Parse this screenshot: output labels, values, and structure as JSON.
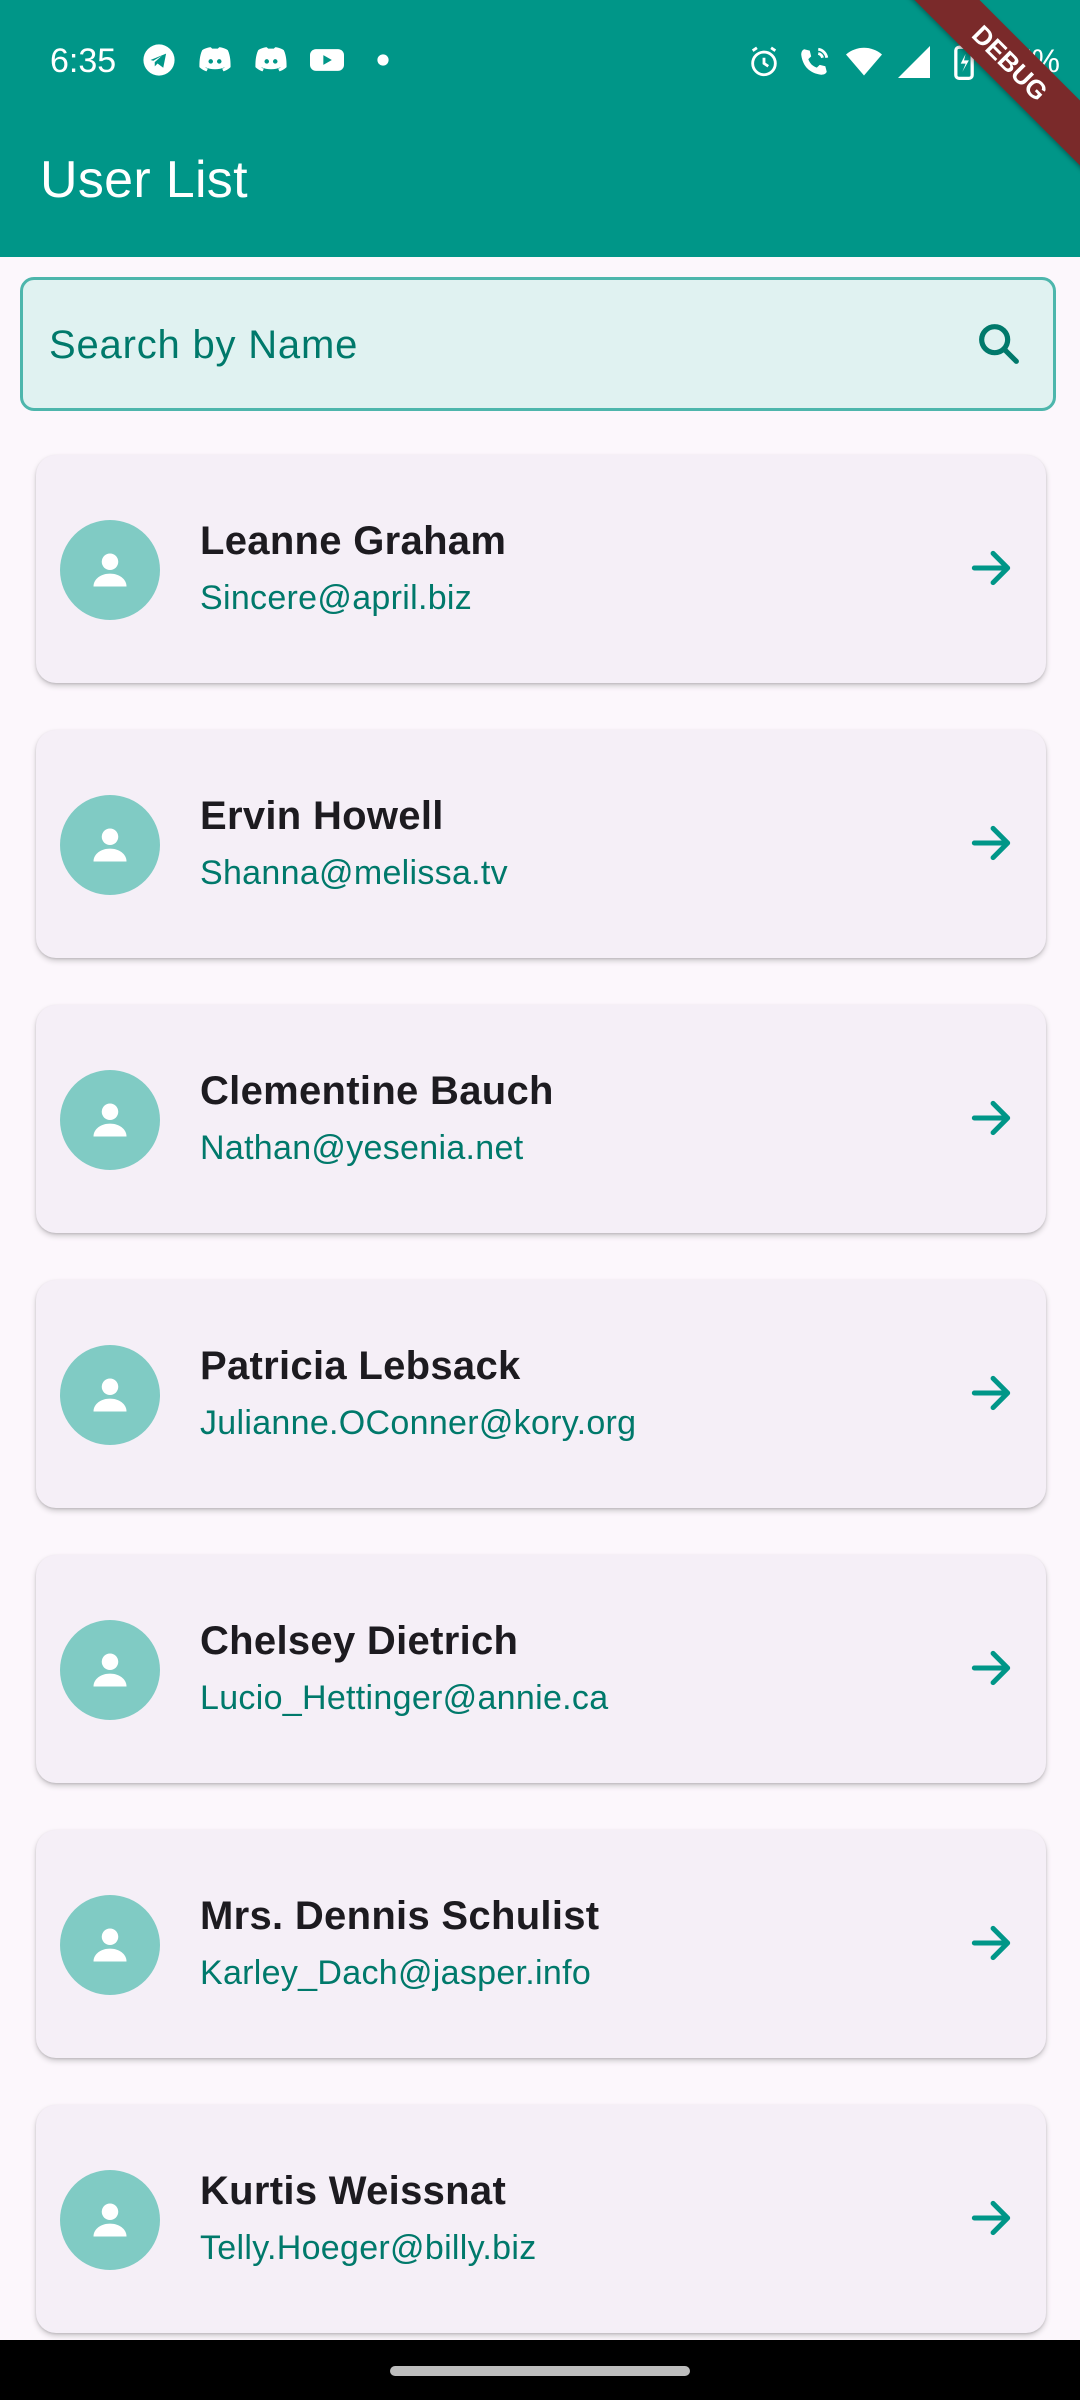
{
  "status_bar": {
    "time": "6:35",
    "battery": "27%",
    "left_icons": [
      "telegram-icon",
      "discord-icon",
      "discord-icon",
      "youtube-icon",
      "dot-icon"
    ],
    "right_icons": [
      "alarm-icon",
      "wifi-calling-icon",
      "wifi-icon",
      "signal-icon",
      "battery-charging-icon"
    ]
  },
  "app_bar": {
    "title": "User List"
  },
  "debug_banner": "DEBUG",
  "search": {
    "placeholder": "Search by Name",
    "value": ""
  },
  "users": [
    {
      "name": "Leanne Graham",
      "email": "Sincere@april.biz"
    },
    {
      "name": "Ervin Howell",
      "email": "Shanna@melissa.tv"
    },
    {
      "name": "Clementine Bauch",
      "email": "Nathan@yesenia.net"
    },
    {
      "name": "Patricia Lebsack",
      "email": "Julianne.OConner@kory.org"
    },
    {
      "name": "Chelsey Dietrich",
      "email": "Lucio_Hettinger@annie.ca"
    },
    {
      "name": "Mrs. Dennis Schulist",
      "email": "Karley_Dach@jasper.info"
    },
    {
      "name": "Kurtis Weissnat",
      "email": "Telly.Hoeger@billy.biz"
    }
  ],
  "colors": {
    "primary": "#009688",
    "avatar_bg": "#80cbc4",
    "email_text": "#00796b",
    "search_bg": "#e0f2f1",
    "card_bg": "#f5eff7"
  }
}
